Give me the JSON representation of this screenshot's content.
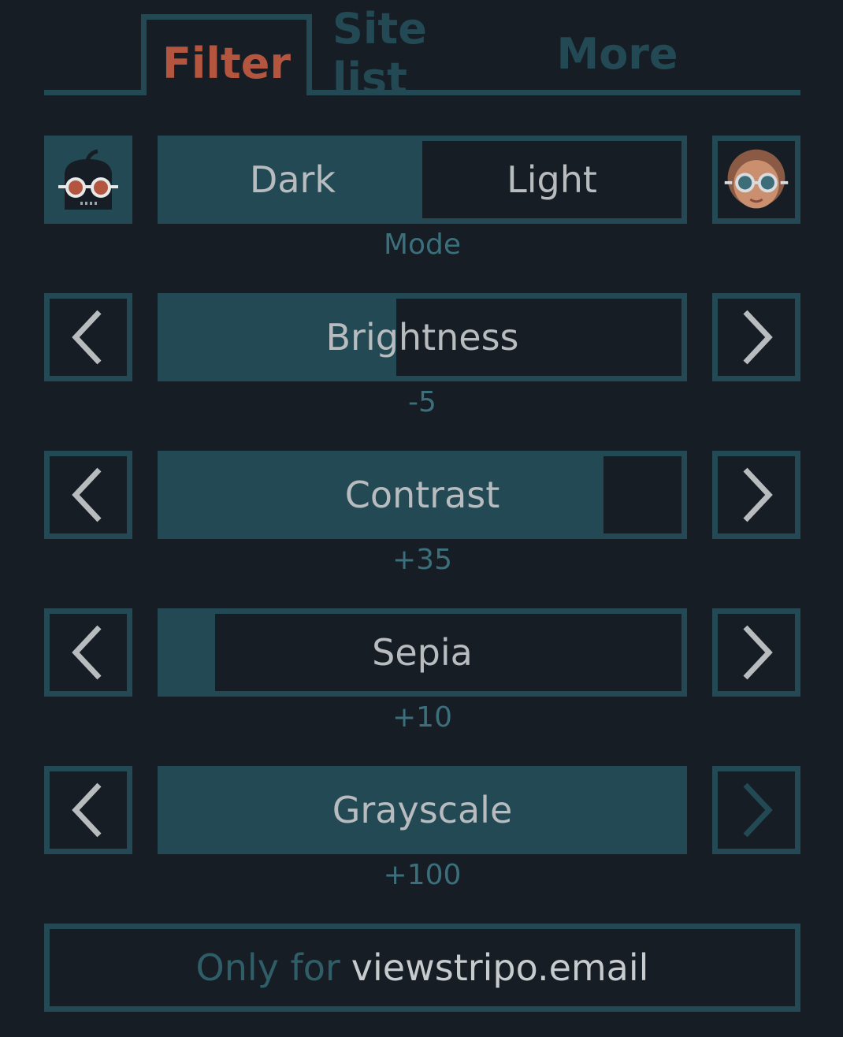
{
  "tabs": [
    {
      "label": "Filter",
      "active": true
    },
    {
      "label": "Site list",
      "active": false
    },
    {
      "label": "More",
      "active": false
    }
  ],
  "mode": {
    "dark_label": "Dark",
    "light_label": "Light",
    "caption": "Mode",
    "selected": "Dark",
    "dark_icon": "glasses-robot-icon",
    "light_icon": "glasses-face-icon"
  },
  "filters": [
    {
      "label": "Brightness",
      "value_text": "-5",
      "fill_fraction": 0.45
    },
    {
      "label": "Contrast",
      "value_text": "+35",
      "fill_fraction": 0.85
    },
    {
      "label": "Sepia",
      "value_text": "+10",
      "fill_fraction": 0.1
    },
    {
      "label": "Grayscale",
      "value_text": "+100",
      "fill_fraction": 1.0
    }
  ],
  "footer": {
    "prefix": "Only for",
    "site": "viewstripo.email"
  },
  "colors": {
    "background": "#161d24",
    "accent": "#224954",
    "active_tab": "#b3553f",
    "label_text": "#b8bcbf",
    "value_text": "#3b6f7c"
  }
}
